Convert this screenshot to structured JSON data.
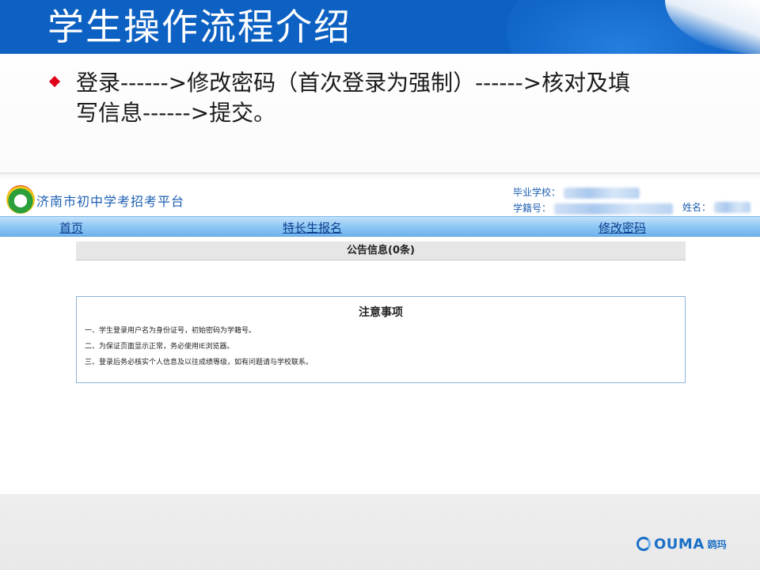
{
  "slide": {
    "title": "学生操作流程介绍",
    "bullet_line1": "登录------>修改密码（首次登录为强制）------>核对及填",
    "bullet_line2": "写信息------>提交。"
  },
  "site": {
    "name": "济南市初中学考招考平台",
    "school_label": "毕业学校：",
    "student_id_label": "学籍号：",
    "name_label": "姓名："
  },
  "nav": {
    "home": "首页",
    "special_signup": "特长生报名",
    "change_password": "修改密码"
  },
  "announcement": {
    "title": "公告信息(0条)"
  },
  "notes": {
    "title": "注意事项",
    "items": [
      "一、学生登录用户名为身份证号，初始密码为学籍号。",
      "二、为保证页面显示正常，务必使用IE浏览器。",
      "三、登录后务必核实个人信息及以往成绩等级，如有问题请与学校联系。"
    ]
  },
  "brand": {
    "word": "OUMA",
    "cn": "鸥玛"
  },
  "colors": {
    "title_band": "#0d61c2",
    "bullet": "#e0001b",
    "nav_link": "#0b3d8f",
    "site_text": "#1d5fb3"
  }
}
